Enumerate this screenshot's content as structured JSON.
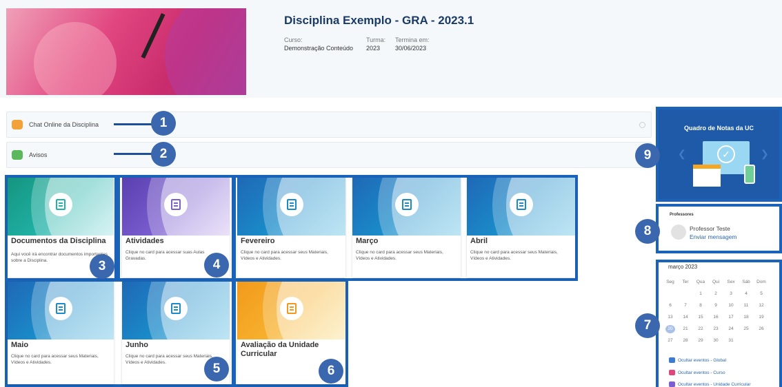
{
  "course": {
    "title": "Disciplina Exemplo - GRA - 2023.1",
    "curso_label": "Curso:",
    "curso_value": "Demonstração Conteúdo",
    "turma_label": "Turma:",
    "turma_value": "2023",
    "termina_label": "Termina em:",
    "termina_value": "30/06/2023"
  },
  "rows": {
    "chat": "Chat Online da Disciplina",
    "avisos": "Avisos"
  },
  "callouts": [
    "1",
    "2",
    "3",
    "4",
    "5",
    "6",
    "7",
    "8",
    "9"
  ],
  "cards": [
    {
      "title": "Documentos da Disciplina",
      "desc": "Aqui você irá encontrar documentos importantes sobre a Disciplina.",
      "color": "#21b3a8"
    },
    {
      "title": "Atividades",
      "desc": "Clique no card para acessar suas Aulas Gravadas.",
      "color": "#7b5fd0"
    },
    {
      "title": "Fevereiro",
      "desc": "Clique no card para acessar seus Materiais, Vídeos e Atividades.",
      "color": "#1a8bc9"
    },
    {
      "title": "Março",
      "desc": "Clique no card para acessar seus Materiais, Vídeos e Atividades.",
      "color": "#1a8bc9"
    },
    {
      "title": "Abril",
      "desc": "Clique no card para acessar seus Materiais, Vídeos e Atividades.",
      "color": "#1a8bc9"
    },
    {
      "title": "Maio",
      "desc": "Clique no card para acessar seus Materiais, Vídeos e Atividades.",
      "color": "#1a8bc9"
    },
    {
      "title": "Junho",
      "desc": "Clique no card para acessar seus Materiais, Vídeos e Atividades.",
      "color": "#1a8bc9"
    },
    {
      "title": "Avaliação da Unidade Curricular",
      "desc": "",
      "color": "#f7b22e"
    }
  ],
  "notas": {
    "title": "Quadro de Notas da UC"
  },
  "professores": {
    "heading": "Professores",
    "name": "Professor Teste",
    "message_link": "Enviar mensagem"
  },
  "calendar": {
    "month": "março 2023",
    "weekdays": [
      "Seg",
      "Ter",
      "Qua",
      "Qui",
      "Sex",
      "Sáb",
      "Dom"
    ],
    "weeks": [
      [
        "",
        "",
        "1",
        "2",
        "3",
        "4",
        "5"
      ],
      [
        "6",
        "7",
        "8",
        "9",
        "10",
        "11",
        "12"
      ],
      [
        "13",
        "14",
        "15",
        "16",
        "17",
        "18",
        "19"
      ],
      [
        "20",
        "21",
        "22",
        "23",
        "24",
        "25",
        "26"
      ],
      [
        "27",
        "28",
        "29",
        "30",
        "31",
        "",
        ""
      ]
    ],
    "today": "20",
    "events": [
      {
        "label": "Ocultar eventos - Global",
        "color": "#3a7bd5"
      },
      {
        "label": "Ocultar eventos - Curso",
        "color": "#e0457b"
      },
      {
        "label": "Ocultar eventos - Unidade Curricular",
        "color": "#7b5fd0"
      }
    ]
  }
}
